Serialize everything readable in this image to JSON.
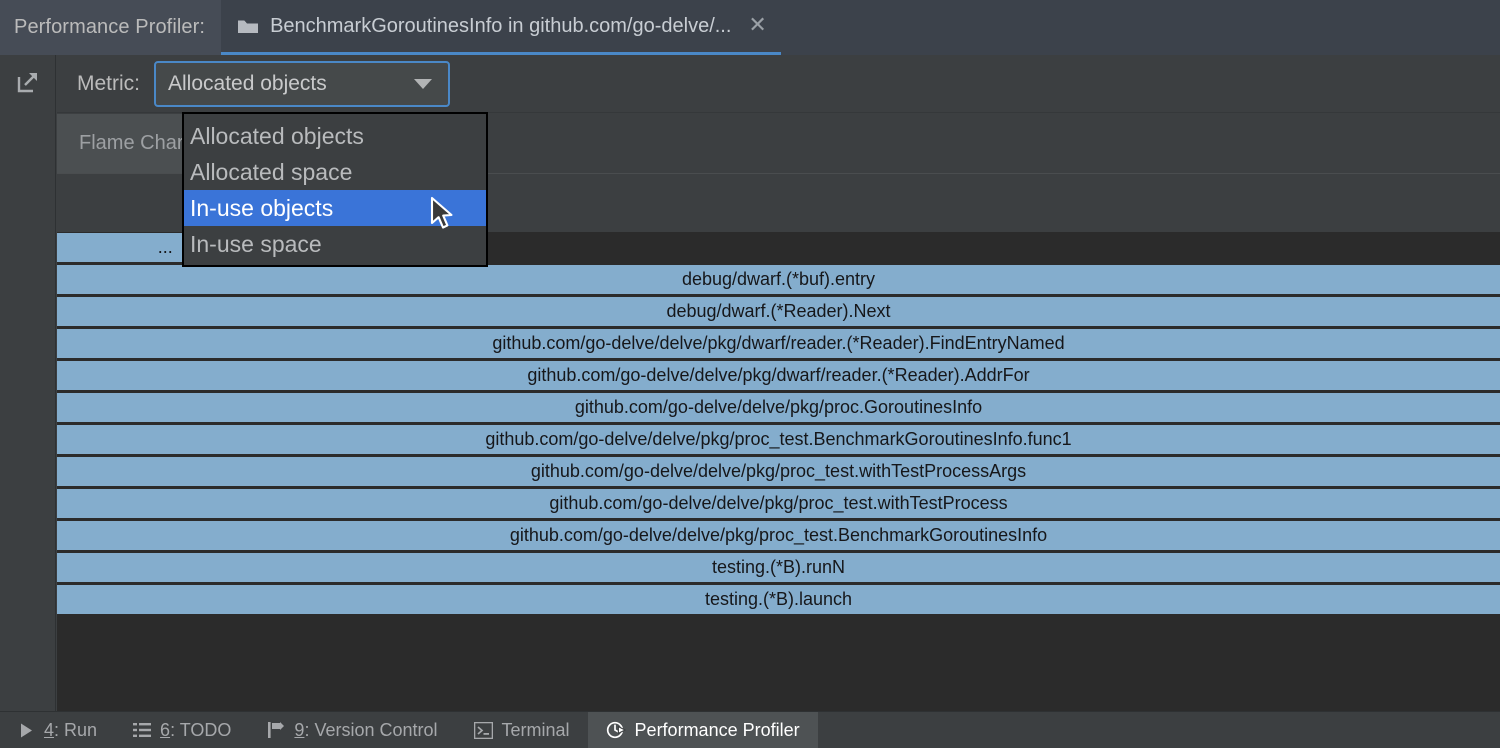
{
  "window": {
    "tool_window_title": "Performance Profiler:",
    "tab": {
      "label": "BenchmarkGoroutinesInfo in github.com/go-delve/...",
      "icon": "folder-icon",
      "close_icon": "close-icon"
    }
  },
  "toolbar": {
    "expand_icon": "open-in-new-window-icon",
    "metric_label": "Metric:",
    "metric_value": "Allocated objects",
    "dropdown_icon": "chevron-down-icon"
  },
  "chart_tabs": [
    {
      "label": "Flame Chart",
      "active": true
    }
  ],
  "dropdown": {
    "open": true,
    "selected": "In-use objects",
    "options": [
      "Allocated objects",
      "Allocated space",
      "In-use objects",
      "In-use space"
    ]
  },
  "colors": {
    "flame_bar": "#84adcd",
    "highlight": "#3a74d8",
    "accent": "#4a88c7",
    "canvas": "#2b2b2b",
    "panel": "#3c3f41"
  },
  "chart_data": {
    "type": "bar",
    "title": "Flame Chart",
    "metric": "Allocated objects",
    "orientation": "icicle-inverted",
    "xlabel": "",
    "ylabel": "",
    "frames": [
      {
        "label": "...",
        "depth": 0,
        "x_pct": 0.0,
        "width_pct": 15.0
      },
      {
        "label": "debug/dwarf.(*buf).entry",
        "depth": 1,
        "x_pct": 0.0,
        "width_pct": 100.0
      },
      {
        "label": "debug/dwarf.(*Reader).Next",
        "depth": 2,
        "x_pct": 0.0,
        "width_pct": 100.0
      },
      {
        "label": "github.com/go-delve/delve/pkg/dwarf/reader.(*Reader).FindEntryNamed",
        "depth": 3,
        "x_pct": 0.0,
        "width_pct": 100.0
      },
      {
        "label": "github.com/go-delve/delve/pkg/dwarf/reader.(*Reader).AddrFor",
        "depth": 4,
        "x_pct": 0.0,
        "width_pct": 100.0
      },
      {
        "label": "github.com/go-delve/delve/pkg/proc.GoroutinesInfo",
        "depth": 5,
        "x_pct": 0.0,
        "width_pct": 100.0
      },
      {
        "label": "github.com/go-delve/delve/pkg/proc_test.BenchmarkGoroutinesInfo.func1",
        "depth": 6,
        "x_pct": 0.0,
        "width_pct": 100.0
      },
      {
        "label": "github.com/go-delve/delve/pkg/proc_test.withTestProcessArgs",
        "depth": 7,
        "x_pct": 0.0,
        "width_pct": 100.0
      },
      {
        "label": "github.com/go-delve/delve/pkg/proc_test.withTestProcess",
        "depth": 8,
        "x_pct": 0.0,
        "width_pct": 100.0
      },
      {
        "label": "github.com/go-delve/delve/pkg/proc_test.BenchmarkGoroutinesInfo",
        "depth": 9,
        "x_pct": 0.0,
        "width_pct": 100.0
      },
      {
        "label": "testing.(*B).runN",
        "depth": 10,
        "x_pct": 0.0,
        "width_pct": 100.0
      },
      {
        "label": "testing.(*B).launch",
        "depth": 11,
        "x_pct": 0.0,
        "width_pct": 100.0
      }
    ]
  },
  "statusbar": {
    "items": [
      {
        "mnemonic": "4",
        "label": ": Run",
        "icon": "run-icon",
        "active": false
      },
      {
        "mnemonic": "6",
        "label": ": TODO",
        "icon": "todo-list-icon",
        "active": false
      },
      {
        "mnemonic": "9",
        "label": ": Version Control",
        "icon": "version-control-icon",
        "active": false
      },
      {
        "mnemonic": "",
        "label": "Terminal",
        "icon": "terminal-icon",
        "active": false
      },
      {
        "mnemonic": "",
        "label": "Performance Profiler",
        "icon": "profiler-icon",
        "active": true
      }
    ]
  }
}
